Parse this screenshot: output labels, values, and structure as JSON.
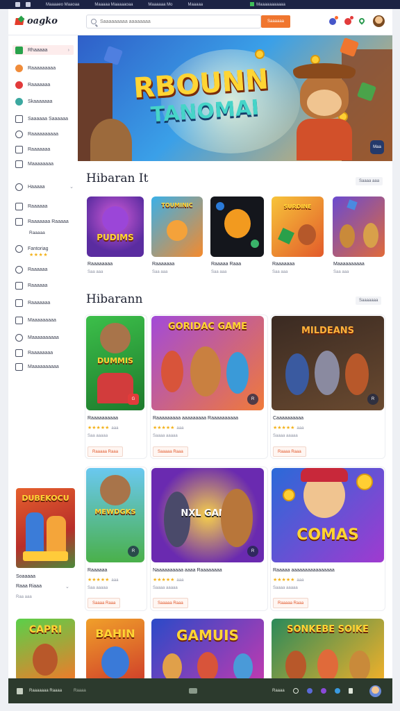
{
  "os_bar": {
    "items": [
      "Maaaaeo Maaoaa",
      "Maaaaa Maaaaaoaa",
      "Maaaaaa Mo",
      "Maaaaa",
      "Maaaaaaaaaaa"
    ]
  },
  "header": {
    "logo_text": "oagko",
    "search_placeholder": "Saaaaaaaaa aaaaaaaa",
    "search_button": "Saaaaaa"
  },
  "sidebar": {
    "items": [
      {
        "label": "Rhaaaaa",
        "icon": "play-icon"
      },
      {
        "label": "Raaaaaaaaa",
        "icon": "character-icon"
      },
      {
        "label": "Raaaaaaa",
        "icon": "target-icon"
      },
      {
        "label": "Skaaaaaaa",
        "icon": "globe-icon"
      },
      {
        "label": "Saaaaaa Saaaaaa",
        "icon": "home-icon"
      },
      {
        "label": "Raaaaaaaaaa",
        "icon": "clock-icon"
      },
      {
        "label": "Raaaaaaa",
        "icon": "chart-icon"
      },
      {
        "label": "Maaaaaaaa",
        "icon": "calendar-icon"
      },
      {
        "label": "Haaaaa",
        "icon": "shield-icon"
      },
      {
        "label": "Raaaaaa",
        "icon": "list-icon"
      },
      {
        "label": "Raaaaaaa Raaaaa",
        "icon": "grid-icon"
      },
      {
        "label": "Raaaaa",
        "icon": "none"
      },
      {
        "label": "Fantoriag",
        "icon": "star-icon"
      },
      {
        "label": "Raaaaaa",
        "icon": "gear-icon"
      },
      {
        "label": "Raaaaaa",
        "icon": "rocket-icon"
      },
      {
        "label": "Raaaaaaa",
        "icon": "flag-icon"
      },
      {
        "label": "Maaaaaaaaa",
        "icon": "book-icon"
      },
      {
        "label": "Maaaaaaaaaa",
        "icon": "shield-icon"
      },
      {
        "label": "Raaaaaaaa",
        "icon": "bag-icon"
      },
      {
        "label": "Maaaaaaaaaa",
        "icon": "cart-icon"
      }
    ],
    "featured": {
      "art_title": "DUBEKOCU",
      "title": "Soaaaaa",
      "subtitle": "Raaa Riaaa",
      "meta": "Raa aaa"
    }
  },
  "hero": {
    "title": "RBOUNN",
    "subtitle": "TANOMAI",
    "badge": "Maa"
  },
  "section1": {
    "title": "Hibaran It",
    "see_all": "Saaaa aaa",
    "tiles": [
      {
        "art": "PUDIMS",
        "name": "Raaaaaaaa",
        "meta": "Saa aaa"
      },
      {
        "art": "TOUMINIC",
        "name": "Raaaaaaa",
        "meta": "Saa aaa"
      },
      {
        "art": "",
        "name": "Raaaaa Raaa",
        "meta": "Saa aaa"
      },
      {
        "art": "SURDINE",
        "name": "Raaaaaaa",
        "meta": "Saa aaa"
      },
      {
        "art": "",
        "name": "Maaaaaaaaaa",
        "meta": "Saa aaa"
      }
    ]
  },
  "section2": {
    "title": "Hibarann",
    "see_all": "Saaaaaaa",
    "cards": [
      {
        "art": "DUMMIS",
        "name": "Raaaaaaaaaa",
        "rating": "★★★★★",
        "count": "aaa",
        "meta": "Saa aaaaa",
        "button": "Raaaaa Raaa",
        "badge": "G"
      },
      {
        "art": "GORIDAC GAME",
        "name": "Raaaaaaaaa aaaaaaaaa Raaaaaaaaaa",
        "rating": "★★★★★",
        "count": "aaa",
        "meta": "Saaaa aaaaa",
        "button": "Saaaaa Raaa",
        "badge": "R"
      },
      {
        "art": "MILDEANS",
        "name": "Caaaaaaaaaa",
        "rating": "★★★★★",
        "count": "aaa",
        "meta": "Saaaa aaaaa",
        "button": "Raaaa Raaa",
        "badge": "R"
      },
      {
        "art": "MEWDGKS",
        "name": "Raaaaaa",
        "rating": "★★★★★",
        "count": "aaa",
        "meta": "Saa aaaaa",
        "button": "Saaaa Raaa",
        "badge": "R"
      },
      {
        "art": "NXL GAMB",
        "name": "Naaaaaaaaaa aaaa Raaaaaaaa",
        "rating": "★★★★★",
        "count": "aaa",
        "meta": "Saaaa aaaaa",
        "button": "Saaaaa Raaa",
        "badge": "R"
      },
      {
        "art": "COMAS",
        "name": "Raaaaa aaaaaaaaaaaaaaaa",
        "rating": "★★★★★",
        "count": "aaa",
        "meta": "Saaaa aaaaa",
        "button": "Raaaaa Raaa",
        "badge": "R"
      }
    ]
  },
  "section3": {
    "tiles": [
      {
        "art": "CAPRI"
      },
      {
        "art": "BAHIN"
      },
      {
        "art": "GAMUIS"
      },
      {
        "art": "SONKEBE SOIKE"
      }
    ]
  },
  "bottombar": {
    "left_label": "Raaaaaaa Raaaa",
    "left_meta": "Raaaa",
    "right_label": "Raaaa"
  },
  "colors": {
    "accent": "#f0762f",
    "star": "#f3b21b",
    "bottom_bar": "#2c3a2d",
    "os_bar": "#1c2344"
  }
}
